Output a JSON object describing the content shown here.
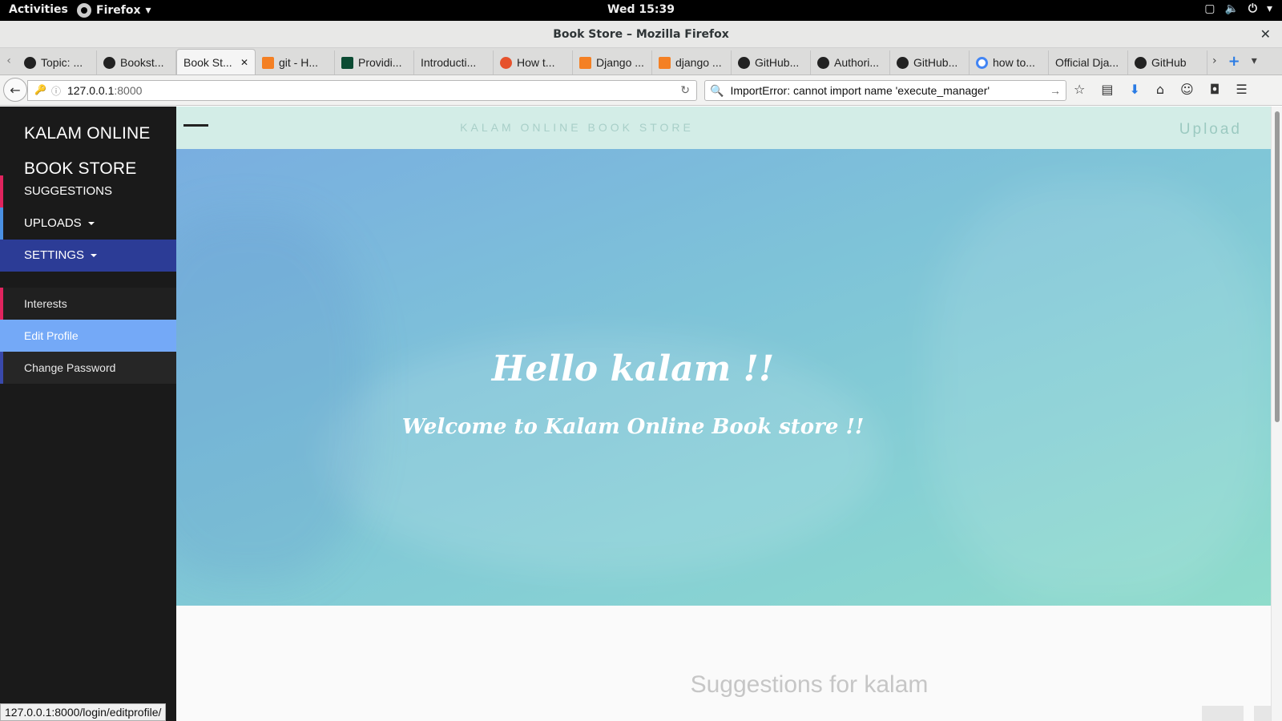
{
  "system": {
    "activities": "Activities",
    "app_name": "Firefox",
    "clock": "Wed 15:39"
  },
  "window": {
    "title": "Book Store – Mozilla Firefox"
  },
  "tabs": [
    {
      "label": "Topic: ...",
      "icon": "github-icon"
    },
    {
      "label": "Bookst...",
      "icon": "github-icon"
    },
    {
      "label": "Book St...",
      "icon": "none",
      "active": true
    },
    {
      "label": "git - H...",
      "icon": "stackoverflow-icon"
    },
    {
      "label": "Providi...",
      "icon": "django-icon"
    },
    {
      "label": "Introducti...",
      "icon": "none"
    },
    {
      "label": "How t...",
      "icon": "ask-icon"
    },
    {
      "label": "Django ...",
      "icon": "stackoverflow-icon"
    },
    {
      "label": "django ...",
      "icon": "stackoverflow-icon"
    },
    {
      "label": "GitHub...",
      "icon": "github-icon"
    },
    {
      "label": "Authori...",
      "icon": "github-icon"
    },
    {
      "label": "GitHub...",
      "icon": "github-icon"
    },
    {
      "label": "how to...",
      "icon": "google-icon"
    },
    {
      "label": "Official Dja...",
      "icon": "none"
    },
    {
      "label": "GitHub",
      "icon": "github-icon"
    }
  ],
  "navbar": {
    "url_host": "127.0.0.1",
    "url_port": ":8000",
    "search_value": "ImportError: cannot import name 'execute_manager'"
  },
  "sidebar": {
    "brand_line1": "KALAM ONLINE",
    "brand_line2": "BOOK STORE",
    "items": [
      {
        "label": "SUGGESTIONS",
        "bar_color": "#e0245e"
      },
      {
        "label": "UPLOADS",
        "bar_color": "#4a90e2"
      },
      {
        "label": "SETTINGS",
        "bar_color": "#2c3c96"
      }
    ],
    "submenu": [
      {
        "label": "Interests",
        "bar_color": "#e0245e"
      },
      {
        "label": "Edit Profile",
        "bar_color": "#74a9f7"
      },
      {
        "label": "Change Password",
        "bar_color": "#3949ab"
      }
    ]
  },
  "header": {
    "title": "KALAM ONLINE BOOK STORE",
    "upload": "Upload"
  },
  "hero": {
    "greeting": "Hello kalam !!",
    "welcome": "Welcome to Kalam Online Book store !!"
  },
  "suggestions": {
    "title": "Suggestions for kalam"
  },
  "status": {
    "link": "127.0.0.1:8000/login/editprofile/"
  }
}
